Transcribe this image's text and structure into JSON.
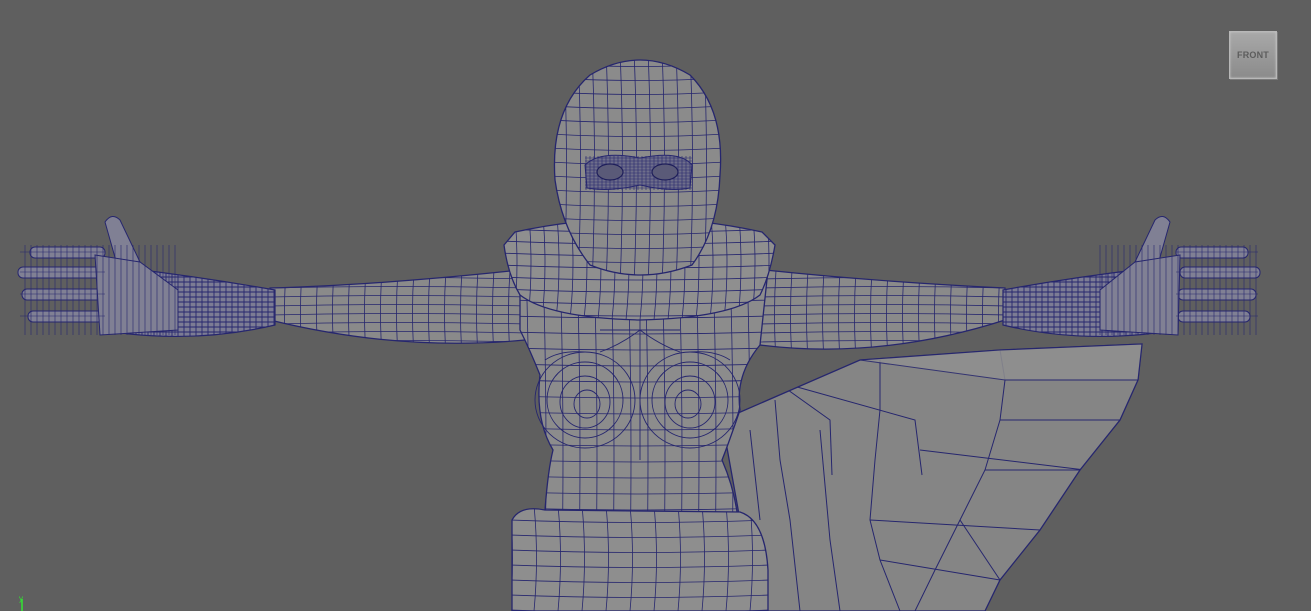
{
  "viewport": {
    "camera_label": "FRONT",
    "background_color": "#5f5f5f"
  },
  "model": {
    "shaded_color": "#8a8a8a",
    "wireframe_color": "#26266e"
  },
  "axis": {
    "label": "y",
    "color": "#32e632"
  }
}
